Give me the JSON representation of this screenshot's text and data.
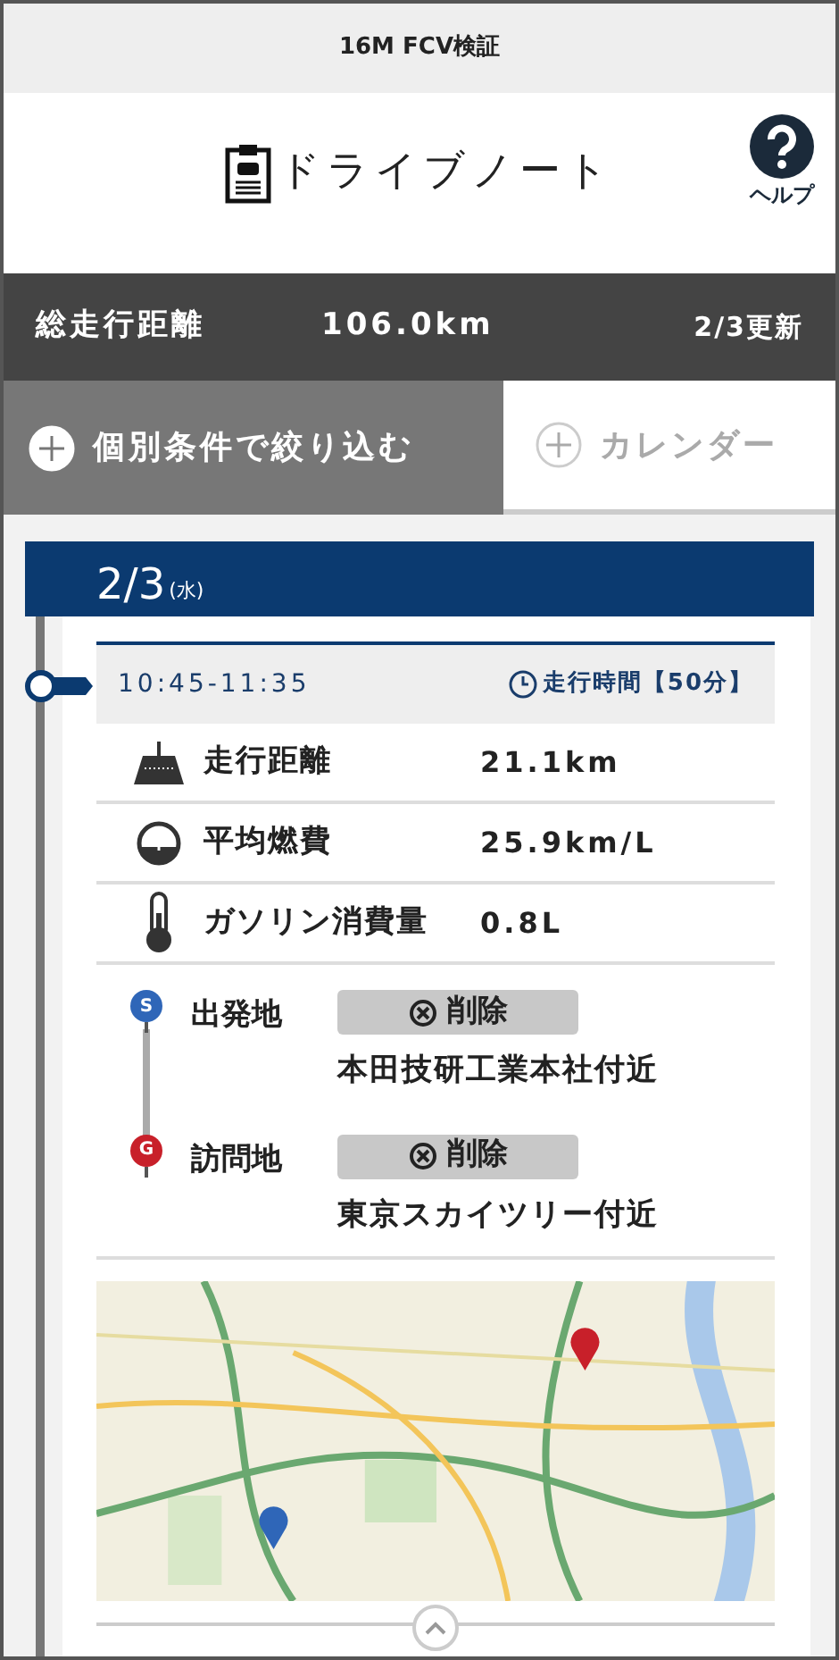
{
  "top_bar": {
    "title": "16M FCV検証"
  },
  "header": {
    "title": "ドライブノート",
    "help_label": "ヘルプ"
  },
  "summary": {
    "label": "総走行距離",
    "value": "106.0km",
    "updated": "2/3更新"
  },
  "tabs": [
    {
      "label": "個別条件で絞り込む",
      "selected": true
    },
    {
      "label": "カレンダー",
      "selected": false
    }
  ],
  "day": {
    "date": "2/3",
    "weekday": "(水)"
  },
  "trip": {
    "time_range": "10:45-11:35",
    "duration": "走行時間【50分】",
    "stats": [
      {
        "kind": "distance",
        "label": "走行距離",
        "value": "21.1km"
      },
      {
        "kind": "economy",
        "label": "平均燃費",
        "value": "25.9km/L"
      },
      {
        "kind": "fuel",
        "label": "ガソリン消費量",
        "value": "0.8L"
      }
    ],
    "places": [
      {
        "kind": "start",
        "pin": "S",
        "label": "出発地",
        "delete_label": "削除",
        "address": "本田技研工業本社付近"
      },
      {
        "kind": "goal",
        "pin": "G",
        "label": "訪問地",
        "delete_label": "削除",
        "address": "東京スカイツリー付近"
      }
    ]
  }
}
